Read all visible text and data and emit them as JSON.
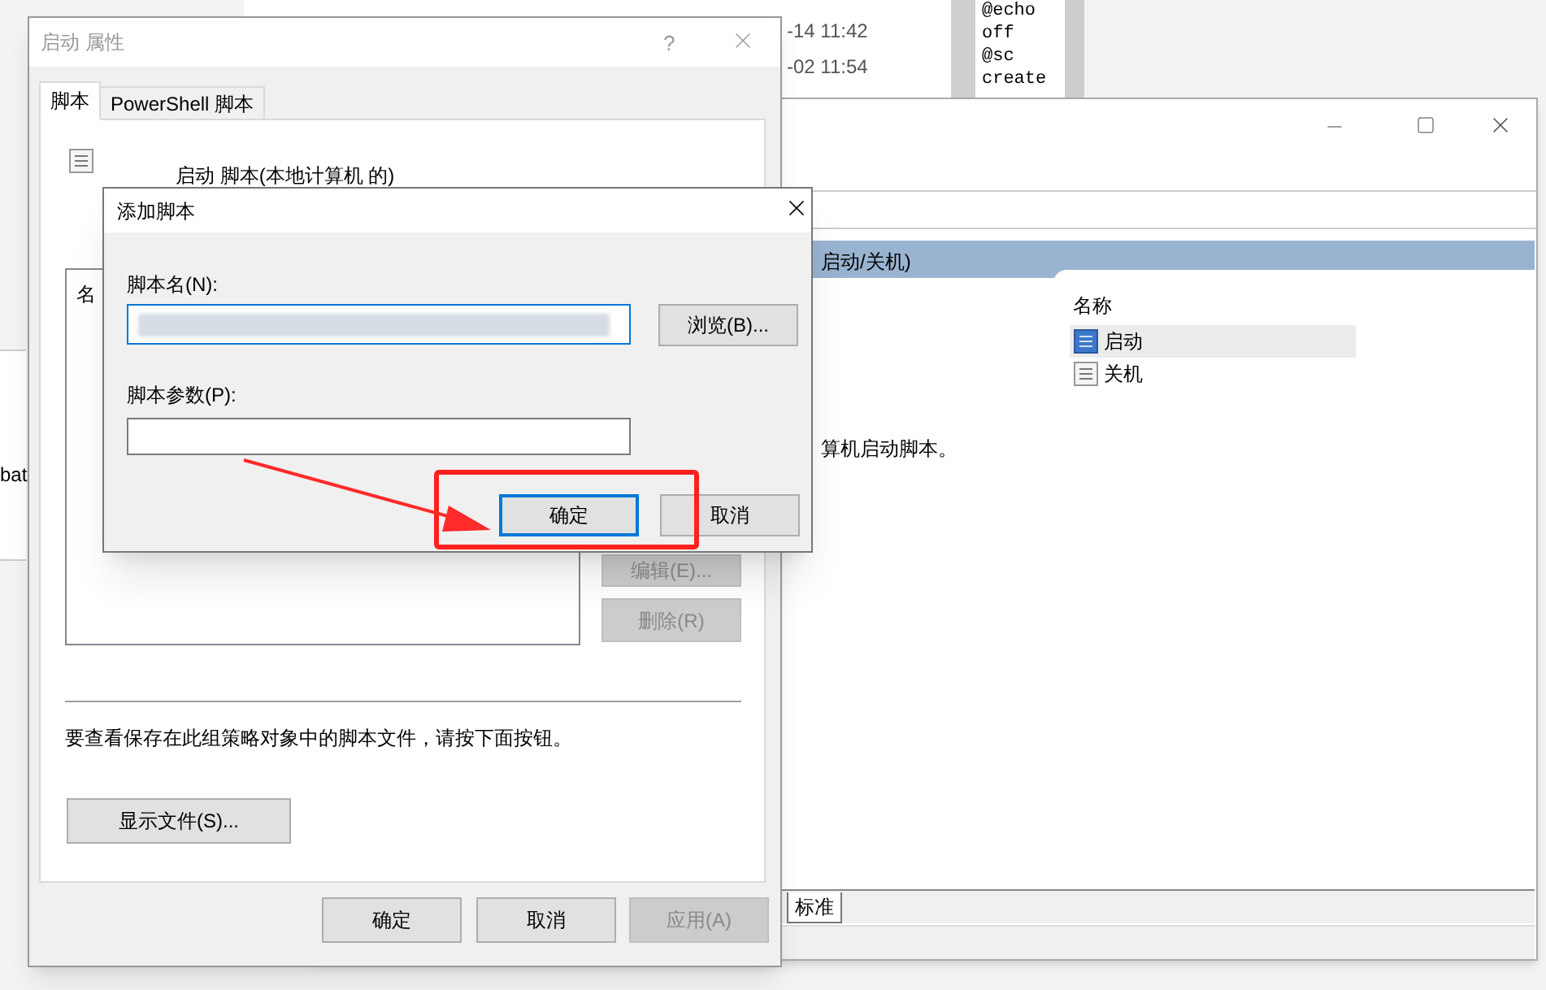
{
  "explorer": {
    "rows": [
      {
        "date": "-14 11:42"
      },
      {
        "date": "-02 11:54"
      }
    ]
  },
  "notepad": {
    "lines": [
      "@echo",
      "off",
      "@sc",
      "create"
    ]
  },
  "left_window": {
    "text": "bat"
  },
  "gpedit": {
    "header": "启动/关机)",
    "column": "名称",
    "items": [
      {
        "label": "启动",
        "selected": true
      },
      {
        "label": "关机",
        "selected": false
      }
    ],
    "description": "算机启动脚本。",
    "tabs": [
      {
        "label": "标准",
        "selected": true
      }
    ]
  },
  "properties_dialog": {
    "title": "启动 属性",
    "help": "?",
    "tabs": [
      {
        "label": "脚本",
        "selected": true
      },
      {
        "label": "PowerShell 脚本",
        "selected": false
      }
    ],
    "heading": "启动 脚本(本地计算机 的)",
    "list_column": "名",
    "side_buttons": [
      {
        "label": "编辑(E)...",
        "disabled": true
      },
      {
        "label": "删除(R)",
        "disabled": true
      }
    ],
    "hint": "要查看保存在此组策略对象中的脚本文件，请按下面按钮。",
    "show_files_button": "显示文件(S)...",
    "buttons": [
      {
        "label": "确定",
        "disabled": false
      },
      {
        "label": "取消",
        "disabled": false
      },
      {
        "label": "应用(A)",
        "disabled": true
      }
    ]
  },
  "add_script_dialog": {
    "title": "添加脚本",
    "name_label": "脚本名(N):",
    "browse_button": "浏览(B)...",
    "params_label": "脚本参数(P):",
    "buttons": [
      {
        "label": "确定",
        "focused": true
      },
      {
        "label": "取消",
        "focused": false
      }
    ]
  }
}
